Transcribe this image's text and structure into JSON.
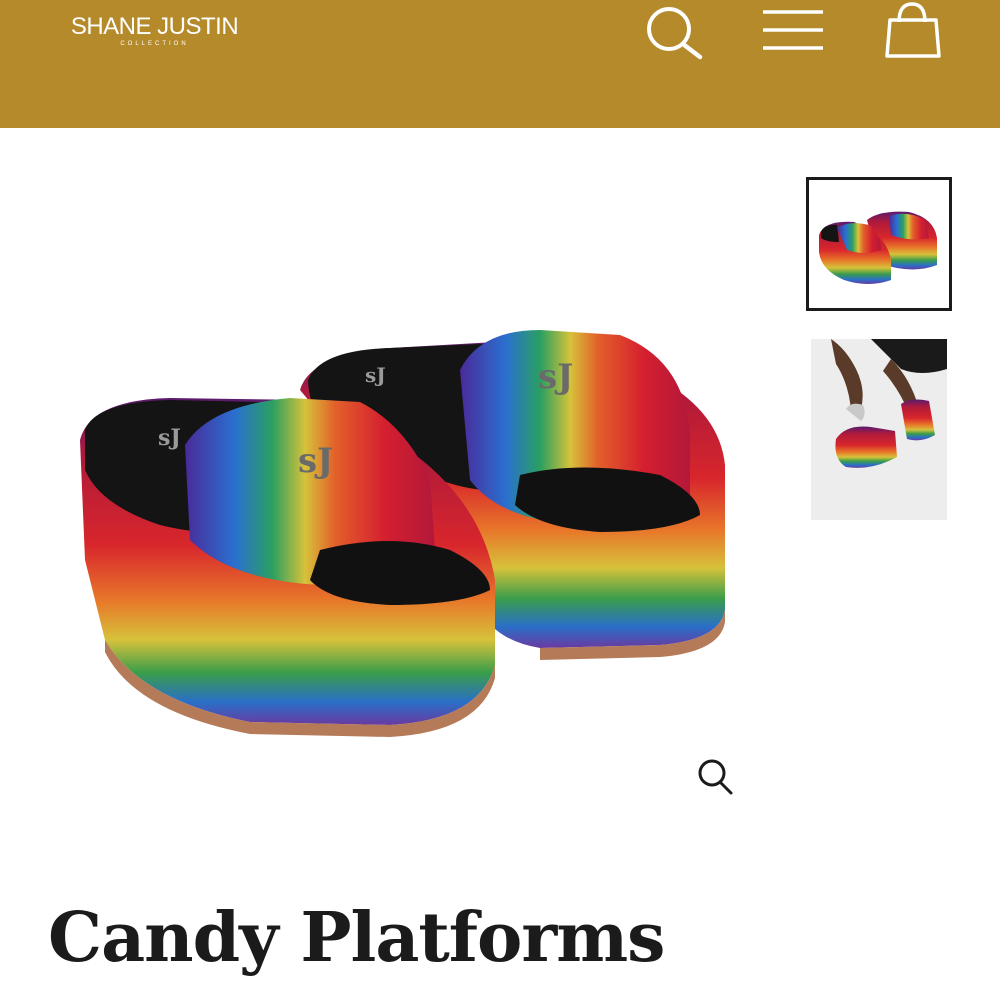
{
  "header": {
    "background_color": "#b48a2a",
    "logo": {
      "main": "SHANE JUSTIN",
      "sub": "COLLECTION"
    },
    "icons": {
      "search": "search-icon",
      "menu": "hamburger-menu-icon",
      "cart": "shopping-bag-icon"
    }
  },
  "gallery": {
    "main_image": "rainbow-glitter-platform-slides-photo",
    "zoom_icon": "magnifier-icon",
    "thumbnails": [
      "platform-slides-product-thumbnail",
      "platform-slides-worn-thumbnail"
    ],
    "selected_thumbnail": 1
  },
  "product": {
    "title": "Candy Platforms"
  }
}
